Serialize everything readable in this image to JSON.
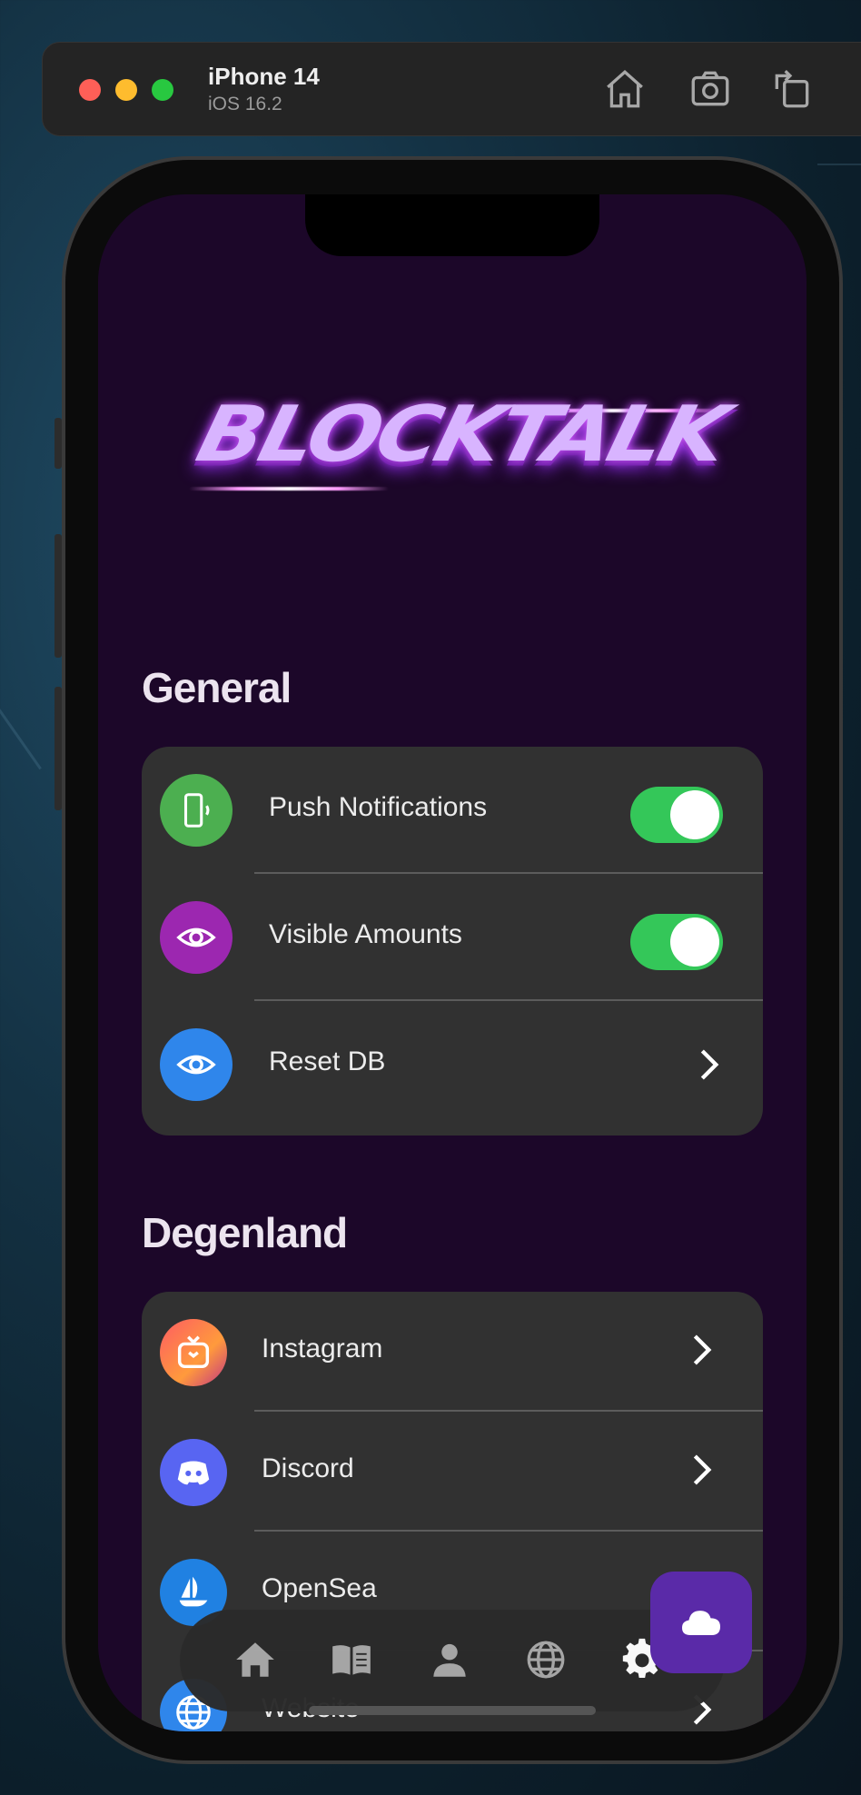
{
  "simulator": {
    "device_name": "iPhone 14",
    "os_version": "iOS 16.2",
    "buttons": [
      "home-icon",
      "screenshot-icon",
      "rotate-icon"
    ]
  },
  "app": {
    "logo_text": "BLOCKTALK",
    "sections": {
      "general": {
        "title": "General",
        "rows": [
          {
            "label": "Push Notifications",
            "icon": "phone-vibrate-icon",
            "icon_color": "#4caf50",
            "control": "toggle",
            "value": true
          },
          {
            "label": "Visible Amounts",
            "icon": "eye-icon",
            "icon_color": "#9c27b0",
            "control": "toggle",
            "value": true
          },
          {
            "label": "Reset DB",
            "icon": "eye-icon",
            "icon_color": "#2f86eb",
            "control": "chevron"
          }
        ]
      },
      "degenland": {
        "title": "Degenland",
        "rows": [
          {
            "label": "Instagram",
            "icon": "instagram-tv-icon",
            "control": "chevron"
          },
          {
            "label": "Discord",
            "icon": "discord-icon",
            "icon_color": "#5865f2",
            "control": "chevron"
          },
          {
            "label": "OpenSea",
            "icon": "opensea-icon",
            "icon_color": "#2081e2",
            "control": "chevron"
          },
          {
            "label": "Website",
            "icon": "globe-icon",
            "icon_color": "#2f86eb",
            "control": "chevron"
          }
        ]
      }
    },
    "tabbar": {
      "tabs": [
        "home-icon",
        "book-icon",
        "person-icon",
        "globe-icon",
        "gear-icon"
      ],
      "active_tab": "gear-icon"
    },
    "fab": {
      "icon": "cloud-icon",
      "color": "#5a2aa8"
    },
    "colors": {
      "background": "#1c0729",
      "card": "#313131",
      "toggle_on": "#34c759"
    }
  }
}
